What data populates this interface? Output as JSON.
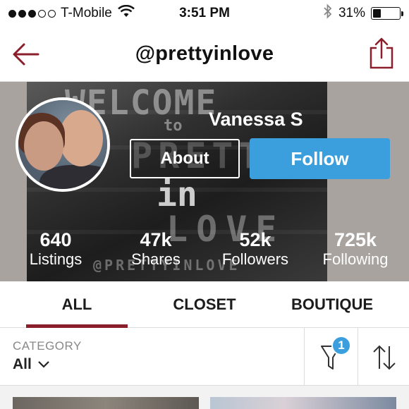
{
  "status_bar": {
    "carrier": "T-Mobile",
    "time": "3:51 PM",
    "battery_percent": "31%",
    "battery_level": 0.31,
    "signal_bars_filled": 3,
    "signal_bars_total": 5
  },
  "nav": {
    "title": "@prettyinlove",
    "back_icon": "back-arrow-icon",
    "share_icon": "share-icon"
  },
  "cover": {
    "art_text": {
      "welcome": "WELCOME",
      "to": "to",
      "prett": "PRETT",
      "in": "in",
      "love": "LOVE",
      "handle": "@PRETTYINLOVE"
    }
  },
  "profile": {
    "name": "Vanessa S",
    "about_label": "About",
    "follow_label": "Follow",
    "stats": [
      {
        "value": "640",
        "label": "Listings"
      },
      {
        "value": "47k",
        "label": "Shares"
      },
      {
        "value": "52k",
        "label": "Followers"
      },
      {
        "value": "725k",
        "label": "Following"
      }
    ]
  },
  "tabs": [
    {
      "label": "ALL",
      "active": true
    },
    {
      "label": "CLOSET",
      "active": false
    },
    {
      "label": "BOUTIQUE",
      "active": false
    }
  ],
  "filter": {
    "category_label": "CATEGORY",
    "category_value": "All",
    "filter_count": "1",
    "filter_icon": "funnel-icon",
    "sort_icon": "sort-arrows-icon"
  },
  "colors": {
    "accent_maroon": "#8a1f2b",
    "follow_blue": "#3a9fdc"
  }
}
